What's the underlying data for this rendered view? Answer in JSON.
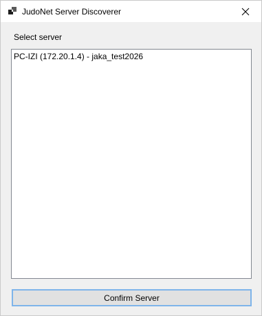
{
  "window": {
    "title": "JudoNet Server Discoverer",
    "app_icon": "app-icon",
    "close_icon": "close-icon"
  },
  "server_select": {
    "label": "Select server",
    "items": [
      {
        "label": "PC-IZI (172.20.1.4) - jaka_test2026"
      }
    ]
  },
  "actions": {
    "confirm_label": "Confirm Server"
  },
  "colors": {
    "button_border_focus": "#7eb4ea",
    "button_face": "#e1e1e1",
    "listbox_border": "#828790",
    "window_bg": "#f0f0f0"
  }
}
